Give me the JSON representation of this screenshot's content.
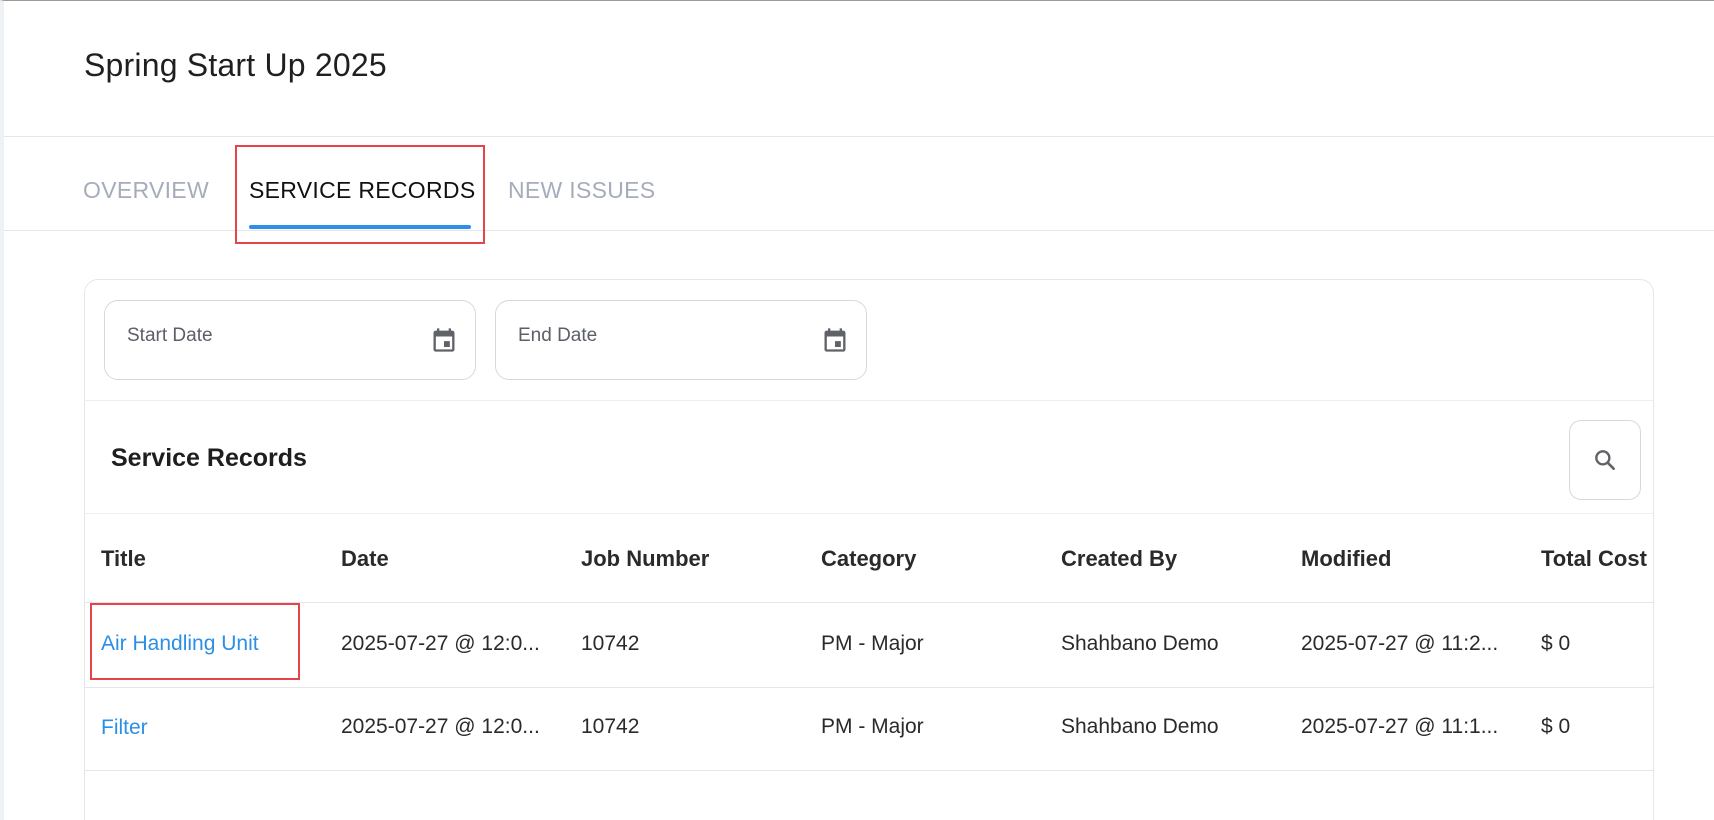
{
  "header": {
    "title": "Spring Start Up 2025"
  },
  "tabs": [
    {
      "label": "OVERVIEW",
      "active": false
    },
    {
      "label": "SERVICE RECORDS",
      "active": true
    },
    {
      "label": "NEW ISSUES",
      "active": false
    }
  ],
  "filters": {
    "start_date_label": "Start Date",
    "end_date_label": "End Date",
    "calendar_icon": "calendar-icon"
  },
  "section": {
    "title": "Service Records",
    "search_icon": "search-icon"
  },
  "table": {
    "columns": [
      "Title",
      "Date",
      "Job Number",
      "Category",
      "Created By",
      "Modified",
      "Total Cost"
    ],
    "rows": [
      {
        "title": "Air Handling Unit",
        "date": "2025-07-27 @ 12:0...",
        "job_number": "10742",
        "category": "PM - Major",
        "created_by": "Shahbano Demo",
        "modified": "2025-07-27 @ 11:2...",
        "total_cost": "$ 0"
      },
      {
        "title": "Filter",
        "date": "2025-07-27 @ 12:0...",
        "job_number": "10742",
        "category": "PM - Major",
        "created_by": "Shahbano Demo",
        "modified": "2025-07-27 @ 11:1...",
        "total_cost": "$ 0"
      }
    ]
  },
  "colors": {
    "accent": "#2e8ee8",
    "link": "#2b8fe6",
    "highlight": "#e4454b",
    "tab_inactive": "#a6acbb"
  }
}
